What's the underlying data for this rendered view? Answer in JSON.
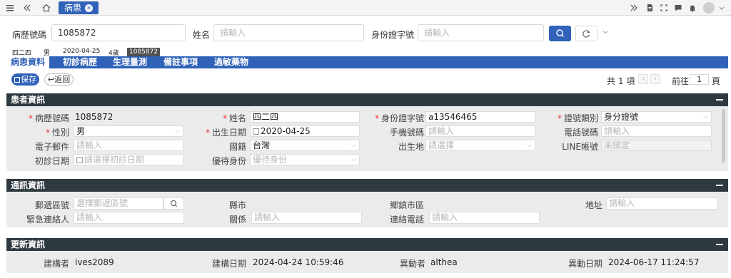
{
  "topbar": {
    "tab_label": "病患",
    "icons": [
      "menu-icon",
      "double-left-icon",
      "home-icon",
      "close-icon",
      "double-right-icon",
      "document-icon",
      "fullscreen-icon",
      "chat-icon",
      "bell-icon",
      "avatar",
      "chevron-down-icon"
    ]
  },
  "search": {
    "chart_no_label": "病歷號碼",
    "chart_no_value": "1085872",
    "name_label": "姓名",
    "name_placeholder": "請輸入",
    "id_label": "身份證字號",
    "id_placeholder": "請輸入"
  },
  "patient_bar": {
    "name": "四二四",
    "gender": "男",
    "birth": "2020-04-25",
    "age": "4歲",
    "chart_no": "1085872"
  },
  "tabs": [
    "病患資料",
    "初診病歷",
    "生理量測",
    "備註事項",
    "過敏藥物"
  ],
  "actions": {
    "save": "保存",
    "back": "返回"
  },
  "pager": {
    "total": "共 1 項",
    "goto": "前往",
    "page": "1",
    "page_suffix": "頁"
  },
  "patient_info": {
    "title": "患者資訊",
    "chart_no_label": "病歷號碼",
    "chart_no": "1085872",
    "name_label": "姓名",
    "name": "四二四",
    "id_label": "身份證字號",
    "id": "a13546465",
    "id_type_label": "證號類別",
    "id_type": "身分證號",
    "gender_label": "性別",
    "gender": "男",
    "birth_label": "出生日期",
    "birth": "2020-04-25",
    "mobile_label": "手機號碼",
    "mobile_placeholder": "請輸入",
    "phone_label": "電話號碼",
    "phone_placeholder": "請輸入",
    "email_label": "電子郵件",
    "email_placeholder": "請輸入",
    "nation_label": "國籍",
    "nation": "台灣",
    "birthplace_label": "出生地",
    "birthplace_placeholder": "請選擇",
    "line_label": "LINE帳號",
    "line_value": "未綁定",
    "first_visit_label": "初診日期",
    "first_visit_placeholder": "請選擇初診日期",
    "priority_label": "優待身份",
    "priority_placeholder": "優待身份"
  },
  "contact_info": {
    "title": "通訊資訊",
    "zip_label": "郵遞區號",
    "zip_placeholder": "選擇郵遞區號",
    "county_label": "縣市",
    "town_label": "鄉鎮市區",
    "address_label": "地址",
    "address_placeholder": "請輸入",
    "emergency_label": "緊急連絡人",
    "emergency_placeholder": "請輸入",
    "relation_label": "關係",
    "relation_placeholder": "請輸入",
    "contact_phone_label": "連絡電話",
    "contact_phone_placeholder": "請輸入"
  },
  "update_info": {
    "title": "更新資訊",
    "creator_label": "建構者",
    "creator": "ives2089",
    "created_label": "建構日期",
    "created": "2024-04-24 10:59:46",
    "modifier_label": "異動者",
    "modifier": "althea",
    "modified_label": "異動日期",
    "modified": "2024-06-17 11:24:57"
  },
  "colors": {
    "primary": "#2f62b8",
    "section_header": "#2f3a40",
    "section_body": "#ebebeb",
    "required": "#e33333"
  }
}
